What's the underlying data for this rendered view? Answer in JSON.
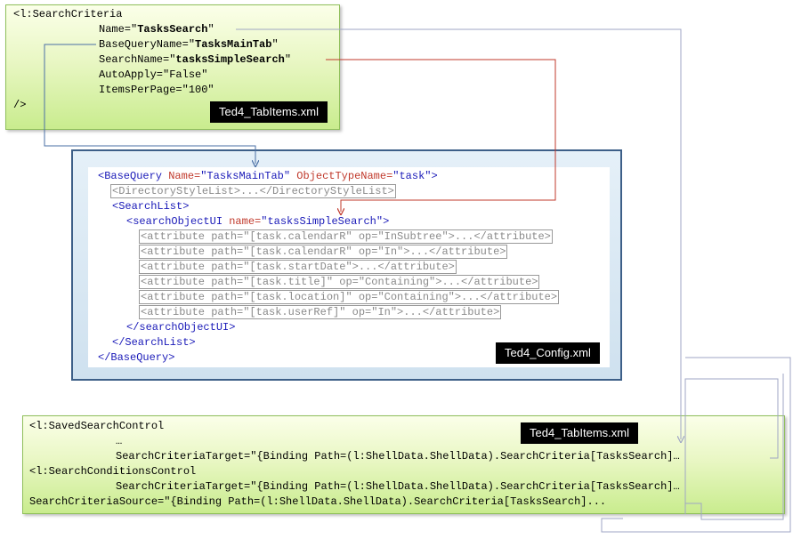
{
  "top_block": {
    "lines": [
      "<l:SearchCriteria",
      "Name=\"TasksSearch\"",
      "BaseQueryName=\"TasksMainTab\"",
      "SearchName=\"tasksSimpleSearch\"",
      "AutoApply=\"False\"",
      "ItemsPerPage=\"100\"",
      "/>"
    ],
    "name_prefix": "Name=\"",
    "name_value": "TasksSearch",
    "name_suffix": "\"",
    "bq_prefix": "BaseQueryName=\"",
    "bq_value": "TasksMainTab",
    "bq_suffix": "\"",
    "sn_prefix": "SearchName=\"",
    "sn_value": "tasksSimpleSearch",
    "sn_suffix": "\"",
    "file_label": "Ted4_TabItems.xml"
  },
  "config_block": {
    "bq_open": "<BaseQuery",
    "bq_name_attr": " Name=",
    "bq_name_val": "\"TasksMainTab\"",
    "bq_type_attr": " ObjectTypeName=",
    "bq_type_val": "\"task\"",
    "bq_close": ">",
    "dir_list": "<DirectoryStyleList>...</DirectoryStyleList>",
    "search_list_open": "<SearchList>",
    "sou_open": "<searchObjectUI",
    "sou_name_attr": " name=",
    "sou_name_val": "\"tasksSimpleSearch\"",
    "sou_close": ">",
    "attributes": [
      "<attribute path=\"[task.calendarR\" op=\"InSubtree\">...</attribute>",
      "<attribute path=\"[task.calendarR\" op=\"In\">...</attribute>",
      "<attribute path=\"[task.startDate\">...</attribute>",
      "<attribute path=\"[task.title]\" op=\"Containing\">...</attribute>",
      "<attribute path=\"[task.location]\" op=\"Containing\">...</attribute>",
      "<attribute path=\"[task.userRef]\" op=\"In\">...</attribute>"
    ],
    "sou_end": "</searchObjectUI>",
    "search_list_end": "</SearchList>",
    "bq_end": "</BaseQuery>",
    "file_label": "Ted4_Config.xml"
  },
  "bottom_block": {
    "lines": [
      "<l:SavedSearchControl",
      "…",
      "SearchCriteriaTarget=\"{Binding Path=(l:ShellData.ShellData).SearchCriteria[TasksSearch]…",
      "<l:SearchConditionsControl",
      "SearchCriteriaTarget=\"{Binding Path=(l:ShellData.ShellData).SearchCriteria[TasksSearch]…",
      "SearchCriteriaSource=\"{Binding Path=(l:ShellData.ShellData).SearchCriteria[TasksSearch]..."
    ],
    "file_label": "Ted4_TabItems.xml"
  },
  "colors": {
    "connector_gray": "#9fa6c4",
    "connector_blue": "#4a6fa5",
    "connector_red": "#c0392b",
    "config_border": "#3d5f88"
  }
}
